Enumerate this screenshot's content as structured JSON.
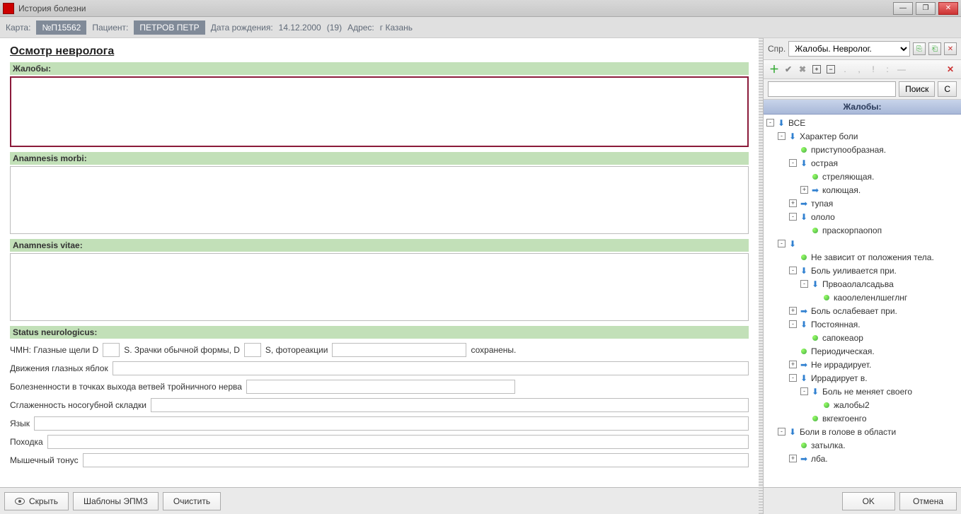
{
  "titlebar": {
    "title": "История болезни"
  },
  "infobar": {
    "card_label": "Карта:",
    "card_value": "№П15562",
    "patient_label": "Пациент:",
    "patient_value": "ПЕТРОВ ПЕТР",
    "dob_label": "Дата рождения:",
    "dob_value": "14.12.2000",
    "age": "(19)",
    "address_label": "Адрес:",
    "address_value": "г Казань"
  },
  "form": {
    "title": "Осмотр невролога",
    "s1": "Жалобы:",
    "s2": "Anamnesis morbi:",
    "s3": "Anamnesis vitae:",
    "s4": "Status neurologicus:",
    "chm_label": "ЧМН: Глазные щели D",
    "zrach_label": "S. Зрачки обычной формы, D",
    "foto_label": "S, фотореакции",
    "sohr": "сохранены.",
    "dvzh": "Движения глазных яблок",
    "bolz": "Болезненности в точках выхода ветвей тройничного нерва",
    "sglz": "Сглаженность носогубной складки",
    "yazyk": "Язык",
    "pohod": "Походка",
    "mysh": "Мышечный тонус"
  },
  "bottom": {
    "hide": "Скрыть",
    "templ": "Шаблоны ЭПМЗ",
    "clear": "Очистить"
  },
  "right": {
    "spr_label": "Спр.",
    "spr_value": "Жалобы. Невролог.",
    "search_btn": "Поиск",
    "clear_btn": "С",
    "tree_header": "Жалобы:",
    "ok": "OK",
    "cancel": "Отмена"
  },
  "tree": [
    {
      "d": 0,
      "tg": "-",
      "ic": "ad",
      "lb": "ВСЕ"
    },
    {
      "d": 1,
      "tg": "-",
      "ic": "ad",
      "lb": "Характер боли"
    },
    {
      "d": 2,
      "tg": "",
      "ic": "dg",
      "lb": "приступообразная."
    },
    {
      "d": 2,
      "tg": "-",
      "ic": "ad",
      "lb": "острая"
    },
    {
      "d": 3,
      "tg": "",
      "ic": "dg",
      "lb": "стреляющая."
    },
    {
      "d": 3,
      "tg": "+",
      "ic": "ar",
      "lb": "колющая."
    },
    {
      "d": 2,
      "tg": "+",
      "ic": "ar",
      "lb": "тупая"
    },
    {
      "d": 2,
      "tg": "-",
      "ic": "ad",
      "lb": "ололо"
    },
    {
      "d": 3,
      "tg": "",
      "ic": "dg",
      "lb": "праскорпаопоп"
    },
    {
      "d": 1,
      "tg": "-",
      "ic": "ad",
      "lb": ""
    },
    {
      "d": 2,
      "tg": "",
      "ic": "dg",
      "lb": "Не зависит от положения тела."
    },
    {
      "d": 2,
      "tg": "-",
      "ic": "ad",
      "lb": "Боль уиливается при."
    },
    {
      "d": 3,
      "tg": "-",
      "ic": "ad",
      "lb": "Првоаолалсадьва"
    },
    {
      "d": 4,
      "tg": "",
      "ic": "dg",
      "lb": "каоолеленлшеглнг"
    },
    {
      "d": 2,
      "tg": "+",
      "ic": "ar",
      "lb": "Боль ослабевает при."
    },
    {
      "d": 2,
      "tg": "-",
      "ic": "ad",
      "lb": "Постоянная."
    },
    {
      "d": 3,
      "tg": "",
      "ic": "dg",
      "lb": "сапокеаор"
    },
    {
      "d": 2,
      "tg": "",
      "ic": "dg",
      "lb": "Периодическая."
    },
    {
      "d": 2,
      "tg": "+",
      "ic": "ar",
      "lb": "Не иррадирует."
    },
    {
      "d": 2,
      "tg": "-",
      "ic": "ad",
      "lb": "Иррадирует в."
    },
    {
      "d": 3,
      "tg": "-",
      "ic": "ad",
      "lb": "Боль не меняет своего"
    },
    {
      "d": 4,
      "tg": "",
      "ic": "dg",
      "lb": "жалобы2"
    },
    {
      "d": 3,
      "tg": "",
      "ic": "dg",
      "lb": "вкгекгоенго"
    },
    {
      "d": 1,
      "tg": "-",
      "ic": "ad",
      "lb": "Боли в голове в области"
    },
    {
      "d": 2,
      "tg": "",
      "ic": "dg",
      "lb": "затылка."
    },
    {
      "d": 2,
      "tg": "+",
      "ic": "ar",
      "lb": "лба."
    }
  ]
}
